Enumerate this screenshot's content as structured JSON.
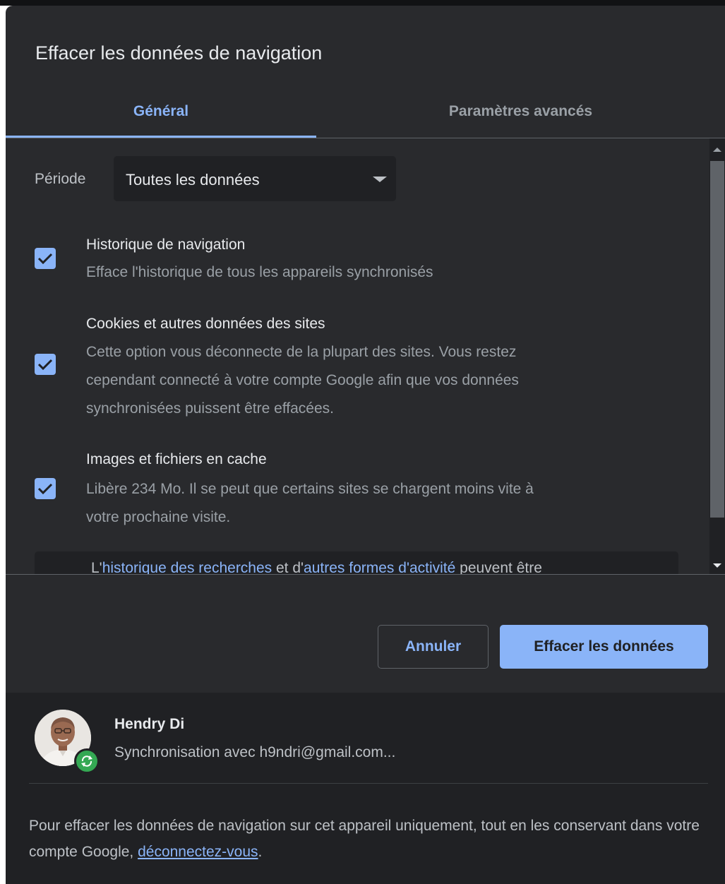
{
  "dialog": {
    "title": "Effacer les données de navigation"
  },
  "tabs": [
    {
      "label": "Général",
      "selected": true
    },
    {
      "label": "Paramètres avancés",
      "selected": false
    }
  ],
  "period": {
    "label": "Période",
    "value": "Toutes les données"
  },
  "options": [
    {
      "title": "Historique de navigation",
      "description": "Efface l'historique de tous les appareils synchronisés",
      "checked": true
    },
    {
      "title": "Cookies et autres données des sites",
      "description_lines": [
        "Cette option vous déconnecte de la plupart des sites. Vous restez",
        "cependant connecté à votre compte Google afin que vos données",
        "synchronisées puissent être effacées."
      ],
      "checked": true
    },
    {
      "title": "Images et fichiers en cache",
      "description_lines": [
        "Libère 234 Mo. Il se peut que certains sites se chargent moins vite à",
        "votre prochaine visite."
      ],
      "checked": true
    }
  ],
  "info": {
    "prefix": "L'",
    "link1": "historique des recherches",
    "middle": " et d'",
    "link2": "autres formes d'activité",
    "suffix": " peuvent être"
  },
  "buttons": {
    "cancel": "Annuler",
    "clear": "Effacer les données"
  },
  "account": {
    "name": "Hendry Di",
    "sync_text": "Synchronisation avec h9ndri@gmail.com..."
  },
  "footer": {
    "text": "Pour effacer les données de navigation sur cet appareil uniquement, tout en les conservant dans votre compte Google, ",
    "link": "déconnectez-vous",
    "end": "."
  },
  "colors": {
    "background": "#292a2d",
    "accent": "#8ab4f8",
    "account_background": "#202124",
    "sync_badge": "#34a853"
  }
}
